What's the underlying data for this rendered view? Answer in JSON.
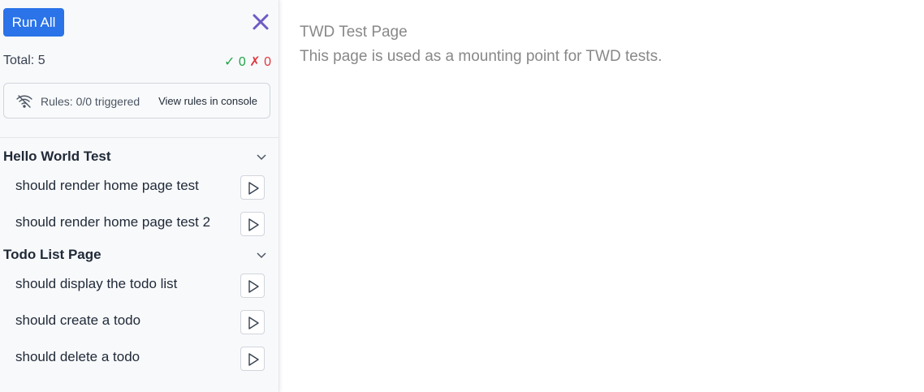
{
  "sidebar": {
    "run_all_label": "Run All",
    "total_label": "Total: 5",
    "passed_count": "✓ 0",
    "failed_count": "✗ 0",
    "rules": {
      "text": "Rules: 0/0 triggered",
      "link": "View rules in console"
    },
    "groups": [
      {
        "title": "Hello World Test",
        "tests": [
          {
            "label": "should render home page test"
          },
          {
            "label": "should render home page test 2"
          }
        ]
      },
      {
        "title": "Todo List Page",
        "tests": [
          {
            "label": "should display the todo list"
          },
          {
            "label": "should create a todo"
          },
          {
            "label": "should delete a todo"
          }
        ]
      }
    ]
  },
  "main": {
    "title": "TWD Test Page",
    "description": "This page is used as a mounting point for TWD tests."
  },
  "colors": {
    "accent": "#2a73e8",
    "close_icon": "#6e5bc6",
    "pass": "#22a447",
    "fail": "#e0383e"
  },
  "icons": [
    "close-icon",
    "wifi-signal-icon",
    "chevron-down-icon",
    "play-icon"
  ]
}
